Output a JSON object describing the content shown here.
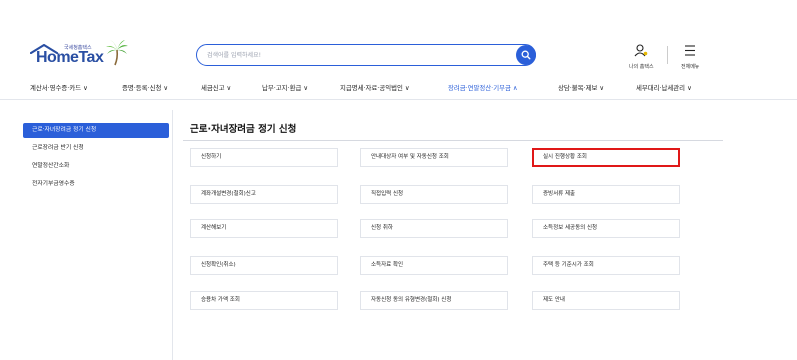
{
  "header": {
    "logo_sub": "국세청홈택스",
    "logo_main": "HomeTax",
    "search_placeholder": "검색어를 입력하세요!",
    "my_hometax_label": "나의 홈택스",
    "all_menu_label": "전체메뉴",
    "accent_color": "#2b5fd9"
  },
  "nav": {
    "items": [
      {
        "label": "계산서·영수증·카드 ∨"
      },
      {
        "label": "증명·등록·신청 ∨"
      },
      {
        "label": "세금신고 ∨"
      },
      {
        "label": "납부·고지·환급 ∨"
      },
      {
        "label": "지급명세·자료·공익법인 ∨"
      },
      {
        "label": "장려금·연말정산·기부금 ∧"
      },
      {
        "label": "상담·불복·제보 ∨"
      },
      {
        "label": "세무대리·납세관리 ∨"
      }
    ]
  },
  "sidebar": {
    "items": [
      {
        "label": "근로·자녀장려금 정기 신청"
      },
      {
        "label": "근로장려금 반기 신청"
      },
      {
        "label": "연말정산간소화"
      },
      {
        "label": "전자기부금영수증"
      }
    ]
  },
  "main": {
    "title": "근로·자녀장려금 정기 신청",
    "cells": [
      {
        "label": "신청하기"
      },
      {
        "label": "안내대상자 여부 및 자동신청 조회"
      },
      {
        "label": "실시 진행상황 조회"
      },
      {
        "label": "계좌개설변경(철회)신고"
      },
      {
        "label": "직접입력 신청"
      },
      {
        "label": "증빙서류 제출"
      },
      {
        "label": "계산해보기"
      },
      {
        "label": "신청 취하"
      },
      {
        "label": "소득정보 세공동의 신청"
      },
      {
        "label": "신청확인(취소)"
      },
      {
        "label": "소득자료 확인"
      },
      {
        "label": "주택 등 기준시가 조회"
      },
      {
        "label": "승용차 가액 조회"
      },
      {
        "label": "자동신청 동의 유형변경(철회) 신청"
      },
      {
        "label": "제도 안내"
      }
    ]
  }
}
